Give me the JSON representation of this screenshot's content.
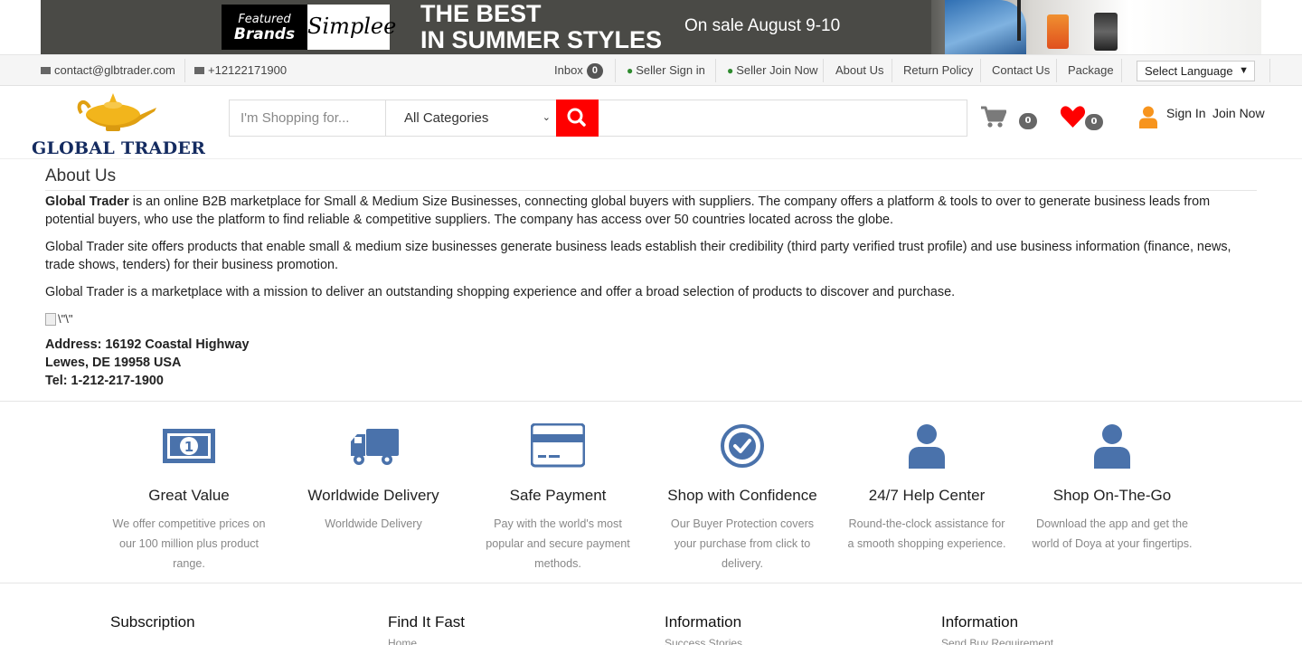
{
  "banner": {
    "featured_line1": "Featured",
    "featured_line2": "Brands",
    "brand_name": "Simplee",
    "headline_line1": "THE BEST",
    "headline_line2": "IN SUMMER STYLES",
    "sale_text": "On sale August 9-10"
  },
  "topbar": {
    "email": "contact@glbtrader.com",
    "phone": "+12122171900",
    "inbox_label": "Inbox",
    "inbox_count": "0",
    "seller_signin": "Seller Sign in",
    "seller_join": "Seller Join Now",
    "about_us": "About Us",
    "return_policy": "Return Policy",
    "contact_us": "Contact Us",
    "package": "Package",
    "language": "Select Language"
  },
  "header": {
    "logo_text": "GLOBAL TRADER",
    "search_placeholder": "I'm Shopping for...",
    "category": "All Categories",
    "cart_count": "0",
    "wishlist_count": "0",
    "sign_in": "Sign In",
    "join_now": "Join Now"
  },
  "colors": {
    "accent_red": "#ff0000",
    "icon_blue": "#4a72ab",
    "logo_navy": "#142b60",
    "user_orange": "#f7941d"
  },
  "content": {
    "title": "About Us",
    "p1_bold": "Global Trader",
    "p1_rest": " is an online B2B marketplace for Small & Medium Size Businesses, connecting global buyers with suppliers. The company offers a platform & tools to over to generate business leads from potential buyers, who use the platform to find reliable & competitive suppliers. The company has access over 50 countries located across the globe.",
    "p2": "Global Trader site offers products that enable small & medium size businesses generate business leads  establish their credibility (third party verified trust profile) and use business information (finance, news, trade shows, tenders) for their business promotion.",
    "p3": "Global Trader is a marketplace with a mission to deliver an outstanding shopping experience and offer a broad selection of products to discover and purchase.",
    "broken_image_alt": "\\\"\\\"",
    "address_line1": "Address: 16192 Coastal Highway",
    "address_line2": "Lewes, DE 19958 USA",
    "tel": "Tel: 1-212-217-1900"
  },
  "features": [
    {
      "icon": "money-icon",
      "title": "Great Value",
      "desc": "We offer competitive prices on our 100 million plus product range."
    },
    {
      "icon": "truck-icon",
      "title": "Worldwide Delivery",
      "desc": "Worldwide Delivery"
    },
    {
      "icon": "credit-card-icon",
      "title": "Safe Payment",
      "desc": "Pay with the world's most popular and secure payment methods."
    },
    {
      "icon": "check-circle-icon",
      "title": "Shop with Confidence",
      "desc": "Our Buyer Protection covers your purchase from click to delivery."
    },
    {
      "icon": "user-icon",
      "title": "24/7 Help Center",
      "desc": "Round-the-clock assistance for a smooth shopping experience."
    },
    {
      "icon": "user-icon",
      "title": "Shop On-The-Go",
      "desc": "Download the app and get the world of Doya at your fingertips."
    }
  ],
  "footer": {
    "columns": [
      {
        "heading": "Subscription",
        "first_link": ""
      },
      {
        "heading": "Find It Fast",
        "first_link": "Home"
      },
      {
        "heading": "Information",
        "first_link": "Success Stories"
      },
      {
        "heading": "Information",
        "first_link": "Send Buy Requirement"
      }
    ]
  }
}
